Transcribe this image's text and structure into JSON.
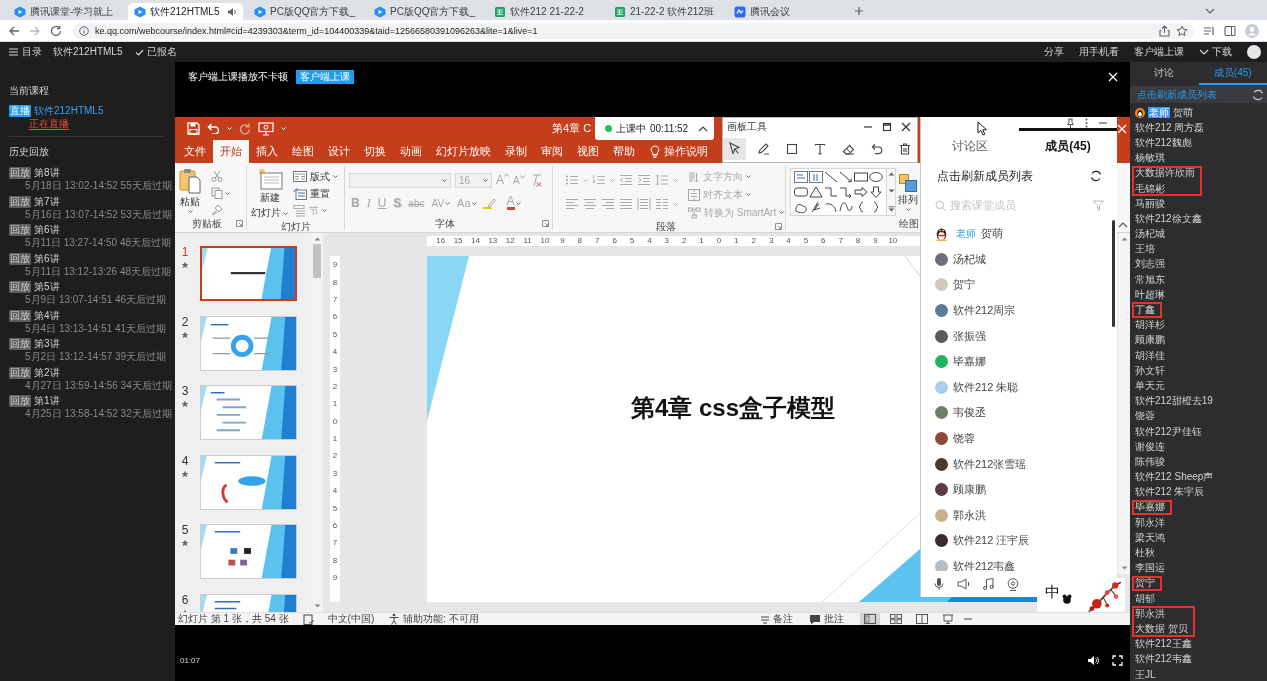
{
  "browser": {
    "tabs": [
      {
        "kind": "classroom",
        "title": "腾讯课堂-学习就上",
        "selected": false,
        "audio": false
      },
      {
        "kind": "classroom",
        "title": "软件212HTML5",
        "selected": true,
        "audio": true
      },
      {
        "kind": "classroom",
        "title": "PC版QQ官方下载_",
        "selected": false,
        "audio": false
      },
      {
        "kind": "classroom",
        "title": "PC版QQ官方下载_",
        "selected": false,
        "audio": false
      },
      {
        "kind": "sheet",
        "title": "软件212 21-22-2",
        "selected": false,
        "audio": false
      },
      {
        "kind": "sheet",
        "title": "21-22-2 软件212班",
        "selected": false,
        "audio": false
      },
      {
        "kind": "meeting",
        "title": "腾讯会议",
        "selected": false,
        "audio": false
      }
    ],
    "url": "ke.qq.com/webcourse/index.html#cid=4239303&term_id=104400339&taid=12566580391096263&lite=1&live=1"
  },
  "top_bar": {
    "menu": "目录",
    "course": "软件212HTML5",
    "enrolled": "已报名",
    "actions": [
      {
        "kind": "text",
        "label": "分享"
      },
      {
        "kind": "text",
        "label": "用手机看"
      },
      {
        "kind": "text",
        "label": "客户端上课"
      },
      {
        "kind": "download",
        "label": "下载"
      }
    ]
  },
  "sidebar": {
    "current_heading": "当前课程",
    "current": {
      "badge": "直播",
      "title": "软件212HTML5",
      "status": "正在直播"
    },
    "history_heading": "历史回放",
    "history": [
      {
        "badge": "回放",
        "title": "第8讲",
        "detail": "5月18日 13:02-14:52 55天后过期"
      },
      {
        "badge": "回放",
        "title": "第7讲",
        "detail": "5月16日 13:07-14:52 53天后过期"
      },
      {
        "badge": "回放",
        "title": "第6讲",
        "detail": "5月11日 13:27-14:50 48天后过期"
      },
      {
        "badge": "回放",
        "title": "第6讲",
        "detail": "5月11日 13:12-13:26 48天后过期"
      },
      {
        "badge": "回放",
        "title": "第5讲",
        "detail": "5月9日 13:07-14:51 46天后过期"
      },
      {
        "badge": "回放",
        "title": "第4讲",
        "detail": "5月4日 13:13-14:51 41天后过期"
      },
      {
        "badge": "回放",
        "title": "第3讲",
        "detail": "5月2日 13:12-14:57 39天后过期"
      },
      {
        "badge": "回放",
        "title": "第2讲",
        "detail": "4月27日 13:59-14:56 34天后过期"
      },
      {
        "badge": "回放",
        "title": "第1讲",
        "detail": "4月25日 13:58-14:52 32天后过期"
      }
    ]
  },
  "player": {
    "banner": {
      "text": "客户端上课播放不卡顿",
      "button": "客户端上课"
    },
    "time": "01:07"
  },
  "ppt": {
    "title": "第4章 C",
    "live": {
      "label": "上课中",
      "time": "00:11:52"
    },
    "tabs": [
      {
        "label": "文件",
        "selected": false
      },
      {
        "label": "开始",
        "selected": true
      },
      {
        "label": "插入",
        "selected": false
      },
      {
        "label": "绘图",
        "selected": false
      },
      {
        "label": "设计",
        "selected": false
      },
      {
        "label": "切换",
        "selected": false
      },
      {
        "label": "动画",
        "selected": false
      },
      {
        "label": "幻灯片放映",
        "selected": false
      },
      {
        "label": "录制",
        "selected": false
      },
      {
        "label": "审阅",
        "selected": false
      },
      {
        "label": "视图",
        "selected": false
      },
      {
        "label": "帮助",
        "selected": false
      }
    ],
    "tell_me": "操作说明",
    "groups": [
      {
        "kind": "clipboard",
        "label": "剪贴板",
        "paste": "粘贴"
      },
      {
        "kind": "slides",
        "label": "幻灯片",
        "new_slide": [
          "新建",
          "幻灯片"
        ],
        "layout": "版式",
        "reset": "重置",
        "section": "节",
        "section_disabled": true
      },
      {
        "kind": "font",
        "label": "字体",
        "disabled": true,
        "size": "16",
        "grow": "A",
        "shrink": "A",
        "formats": [
          "B",
          "I",
          "U",
          "S",
          "abc",
          "AV",
          "Aa"
        ],
        "font_color": "A"
      },
      {
        "kind": "paragraph",
        "label": "段落",
        "disabled": true,
        "text_direction": "文字方向",
        "align_text": "对齐文本",
        "smartart": "转换为 SmartArt"
      },
      {
        "kind": "drawing",
        "label": "绘图",
        "arrange": "排列"
      }
    ],
    "slides": [
      {
        "number": "1",
        "selected": true,
        "animated": true
      },
      {
        "number": "2",
        "selected": false,
        "animated": true
      },
      {
        "number": "3",
        "selected": false,
        "animated": true
      },
      {
        "number": "4",
        "selected": false,
        "animated": true
      },
      {
        "number": "5",
        "selected": false,
        "animated": true
      },
      {
        "number": "6",
        "selected": false,
        "animated": true
      }
    ],
    "hruler": [
      "16",
      "15",
      "14",
      "13",
      "12",
      "11",
      "10",
      "9",
      "8",
      "7",
      "6",
      "5",
      "4",
      "3",
      "2",
      "1",
      "0",
      "1",
      "2",
      "3",
      "4",
      "5",
      "6",
      "7",
      "8",
      "9",
      "10"
    ],
    "vruler": [
      "9",
      "8",
      "7",
      "6",
      "5",
      "4",
      "3",
      "2",
      "1",
      "0",
      "1",
      "2",
      "3",
      "4",
      "5",
      "6",
      "7",
      "8",
      "9"
    ],
    "slide_title": "第4章 css盒子模型",
    "status": {
      "slide_info": "幻灯片 第 1 张，共 54 张",
      "language": "中文(中国)",
      "accessibility": "辅助功能: 不可用",
      "notes": "备注",
      "comments": "批注",
      "views": [
        {
          "selected": true
        },
        {
          "selected": false
        },
        {
          "selected": false
        },
        {
          "selected": false
        }
      ]
    }
  },
  "board_tools": {
    "title": "画板工具",
    "tools": [
      {
        "selected": true
      },
      {
        "selected": false
      },
      {
        "selected": false
      },
      {
        "selected": false
      },
      {
        "selected": false
      },
      {
        "selected": false
      },
      {
        "selected": false
      }
    ]
  },
  "discussion": {
    "tabs": [
      {
        "label": "讨论区",
        "selected": false
      },
      {
        "label": "成员(45)",
        "selected": true
      }
    ],
    "refresh": "点击刷新成员列表",
    "search_placeholder": "搜索课堂成员",
    "members": [
      {
        "kind": "teacher",
        "role": "老师",
        "name": "贺萌"
      },
      {
        "kind": "student",
        "name": "汤杞城",
        "color": "#6e6e78"
      },
      {
        "kind": "student",
        "name": "贺宁",
        "color": "#cfc9bf"
      },
      {
        "kind": "student",
        "name": "软件212周宗",
        "color": "#5f7a96"
      },
      {
        "kind": "student",
        "name": "张振强",
        "color": "#5a5a5a"
      },
      {
        "kind": "student",
        "name": "毕嘉娜",
        "color": "#22b35e"
      },
      {
        "kind": "student",
        "name": "软件212 朱聪",
        "color": "#a8cdee"
      },
      {
        "kind": "student",
        "name": "韦俊丞",
        "color": "#6f7f68"
      },
      {
        "kind": "student",
        "name": "饶蓉",
        "color": "#8b4a3a"
      },
      {
        "kind": "student",
        "name": "软件212张雪瑶",
        "color": "#4b3a2e"
      },
      {
        "kind": "student",
        "name": "顾康鹏",
        "color": "#5b3b40"
      },
      {
        "kind": "student",
        "name": "郭永洪",
        "color": "#c8b08c"
      },
      {
        "kind": "student",
        "name": "软件212 汪宇辰",
        "color": "#3b2a2e"
      },
      {
        "kind": "student",
        "name": "软件212韦鑫",
        "color": "#b5bcc4"
      }
    ]
  },
  "ime": {
    "mode": "中"
  },
  "members_panel": {
    "tabs": [
      {
        "label": "讨论",
        "selected": false
      },
      {
        "label": "成员(45)",
        "selected": true
      }
    ],
    "refresh": "点击刷新成员列表",
    "teacher": {
      "role": "老师",
      "name": "贺萌"
    },
    "members": [
      {
        "name": "软件212 周方磊",
        "marked": false
      },
      {
        "name": "软件212魏彪",
        "marked": false
      },
      {
        "name": "杨敏琪",
        "marked": false
      },
      {
        "name": "大数据许欣雨",
        "marked": true
      },
      {
        "name": "毛锦彬",
        "marked": true
      },
      {
        "name": "马丽骏",
        "marked": false
      },
      {
        "name": "软件212徐文鑫",
        "marked": false
      },
      {
        "name": "汤杞城",
        "marked": false
      },
      {
        "name": "王培",
        "marked": false
      },
      {
        "name": "刘志强",
        "marked": false
      },
      {
        "name": "常旭东",
        "marked": false
      },
      {
        "name": "叶超琳",
        "marked": false
      },
      {
        "name": "丁鑫",
        "marked": true
      },
      {
        "name": "胡洋杉",
        "marked": false
      },
      {
        "name": "顾康鹏",
        "marked": false
      },
      {
        "name": "胡洋佳",
        "marked": false
      },
      {
        "name": "孙文轩",
        "marked": false
      },
      {
        "name": "单天元",
        "marked": false
      },
      {
        "name": "软件212甜橙去19",
        "marked": false
      },
      {
        "name": "饶蓉",
        "marked": false
      },
      {
        "name": "软件212尹佳钰",
        "marked": false
      },
      {
        "name": "谢俊连",
        "marked": false
      },
      {
        "name": "陈伟骏",
        "marked": false
      },
      {
        "name": "软件212 Sheep声",
        "marked": false
      },
      {
        "name": "软件212 朱宇辰",
        "marked": false
      },
      {
        "name": "毕嘉娜",
        "marked": true
      },
      {
        "name": "郭永洋",
        "marked": false
      },
      {
        "name": "梁天鸿",
        "marked": false
      },
      {
        "name": "杜秋",
        "marked": false
      },
      {
        "name": "李国运",
        "marked": false
      },
      {
        "name": "贺宁",
        "marked": true
      },
      {
        "name": "胡郁",
        "marked": false
      },
      {
        "name": "郭永洪",
        "marked": true
      },
      {
        "name": "大数据 贺贝",
        "marked": true
      },
      {
        "name": "软件212王鑫",
        "marked": false
      },
      {
        "name": "软件212韦鑫",
        "marked": false
      },
      {
        "name": "王JL",
        "marked": false
      }
    ]
  }
}
